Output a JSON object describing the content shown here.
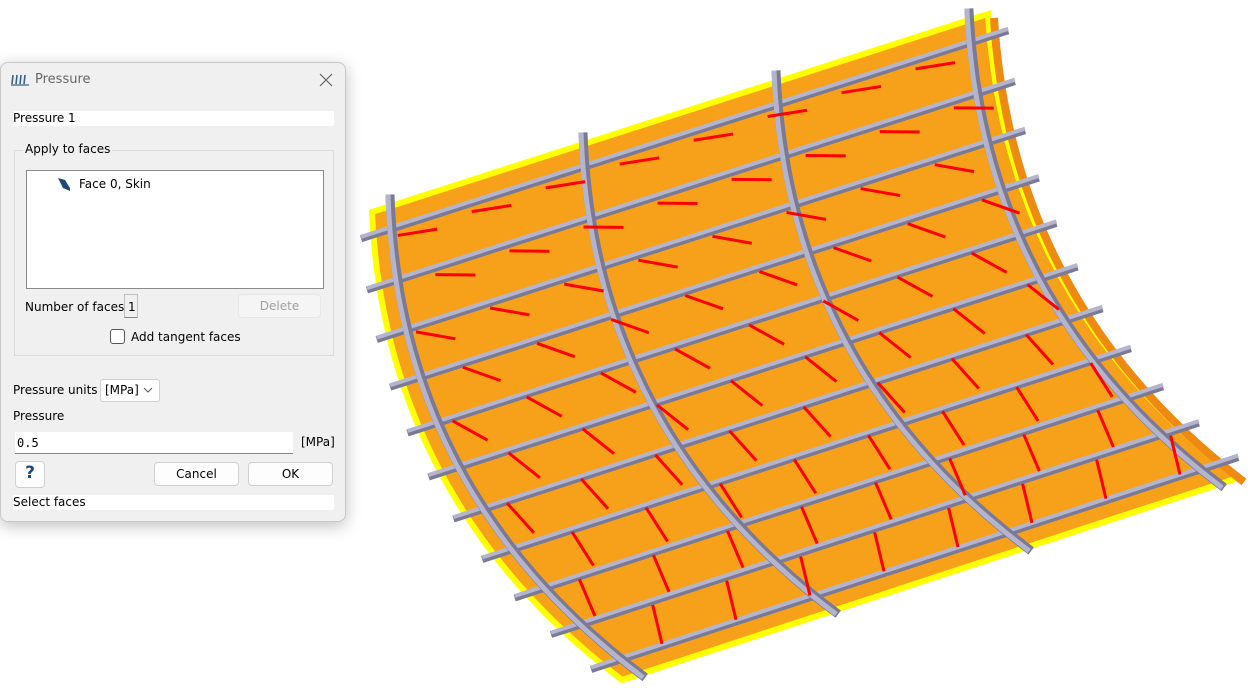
{
  "dialog": {
    "title": "Pressure",
    "title_icon": "pressure-arrows-icon",
    "name_value": "Pressure 1",
    "group_label": "Apply to faces",
    "faces": [
      {
        "label": "Face 0, Skin",
        "icon": "face-icon"
      }
    ],
    "number_of_faces_label": "Number of faces",
    "number_of_faces": "1",
    "delete_label": "Delete",
    "add_tangent_label": "Add tangent faces",
    "add_tangent_checked": false,
    "units_label": "Pressure units",
    "units_value": "[MPa]",
    "pressure_label": "Pressure",
    "pressure_value": "0.5",
    "pressure_unit": "[MPa]",
    "help_label": "?",
    "cancel_label": "Cancel",
    "ok_label": "OK",
    "status_text": "Select faces"
  },
  "model": {
    "colors": {
      "panel": "#f7a11a",
      "panel_dark": "#ef8a10",
      "edge": "#ffff00",
      "stiffener": "#b4b4cc",
      "stiffener_dark": "#7a7a96",
      "arrow": "#ff0000"
    },
    "ribs": 4,
    "stringers": 11
  }
}
